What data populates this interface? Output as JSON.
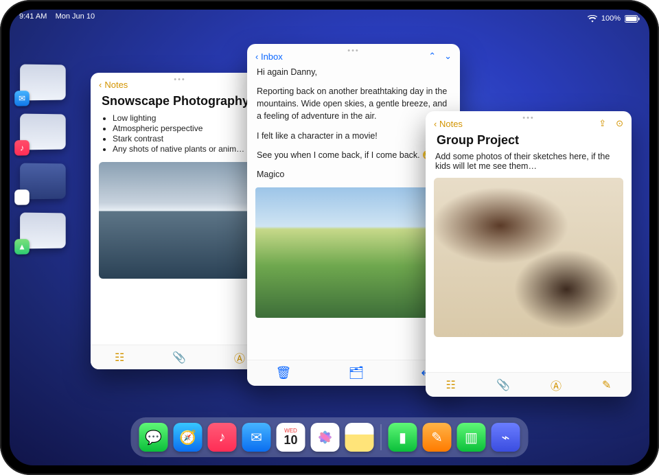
{
  "status": {
    "time": "9:41 AM",
    "date": "Mon Jun 10",
    "battery": "100%"
  },
  "notes1": {
    "back": "Notes",
    "title": "Snowscape Photography",
    "bullets": [
      "Low lighting",
      "Atmospheric perspective",
      "Stark contrast",
      "Any shots of native plants or anim…"
    ]
  },
  "mail": {
    "back": "Inbox",
    "p1": "Hi again Danny,",
    "p2": "Reporting back on another breathtaking day in the mountains. Wide open skies, a gentle breeze, and a feeling of adventure in the air.",
    "p3": "I felt like a character in a movie!",
    "p4": "See you when I come back, if I come back. 😬",
    "p5": "Magico"
  },
  "notes2": {
    "back": "Notes",
    "title": "Group Project",
    "sub": "Add some photos of their sketches here, if the kids will let me see them…"
  },
  "cal": {
    "label": "WED",
    "day": "10"
  }
}
